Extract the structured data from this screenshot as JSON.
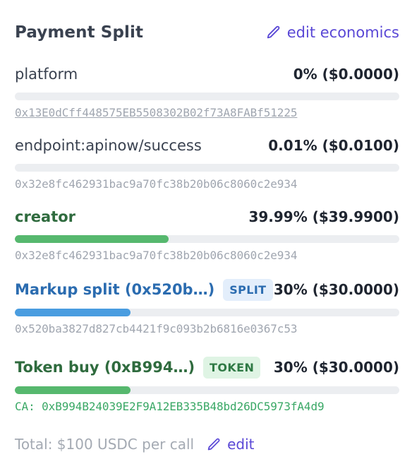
{
  "header": {
    "title": "Payment Split",
    "edit_label": "edit economics"
  },
  "rows": [
    {
      "label": "platform",
      "pct": "0% ($0.0000)",
      "fill": 0,
      "address": "0x13E0dCff448575EB5508302B02f73A8FABf51225"
    },
    {
      "label": "endpoint:apinow/success",
      "pct": "0.01% ($0.0100)",
      "fill": 0.0001,
      "address": "0x32e8fc462931bac9a70fc38b20b06c8060c2e934"
    },
    {
      "label": "creator",
      "pct": "39.99% ($39.9900)",
      "fill": 0.3999,
      "address": "0x32e8fc462931bac9a70fc38b20b06c8060c2e934"
    },
    {
      "label": "Markup split (0x520b…)",
      "badge": "SPLIT",
      "pct": "30% ($30.0000)",
      "fill": 0.3,
      "address": "0x520ba3827d827cb4421f9c093b2b6816e0367c53"
    },
    {
      "label": "Token buy (0xB994…)",
      "badge": "TOKEN",
      "pct": "30% ($30.0000)",
      "fill": 0.3,
      "address": "CA: 0xB994B24039E2F9A12EB335B48bd26DC5973fA4d9"
    }
  ],
  "footer": {
    "total": "Total: $100 USDC per call",
    "edit_label": "edit"
  },
  "colors": {
    "accent": "#5a48d6",
    "green": "#56b86e",
    "blue": "#4a9de0"
  }
}
